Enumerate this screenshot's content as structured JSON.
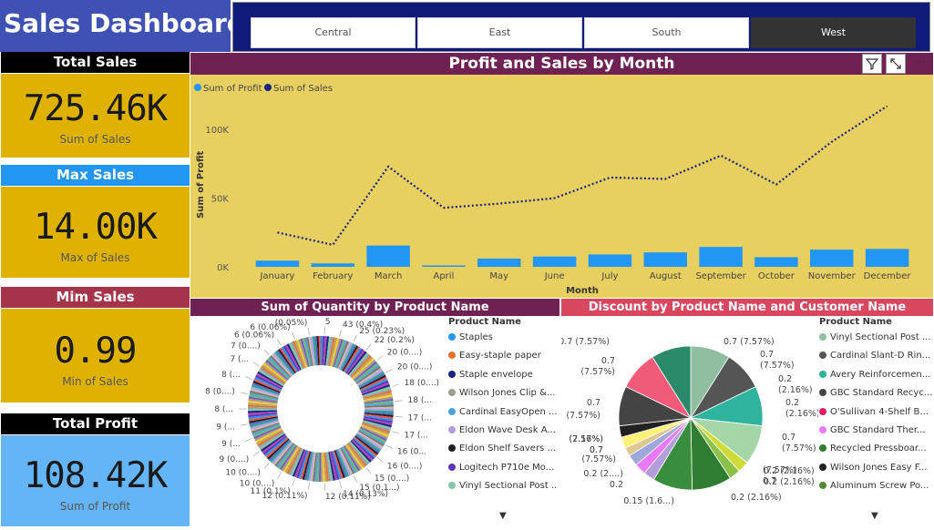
{
  "title": "Sales Dashboard",
  "slicer": [
    "Central",
    "East",
    "South",
    "West"
  ],
  "slicer_selected": "West",
  "kpis": [
    {
      "header": "Total Sales",
      "value": "725.46K",
      "sub": "Sum of Sales",
      "header_color": "#000000",
      "body_color": "#dfb200"
    },
    {
      "header": "Max Sales",
      "value": "14.00K",
      "sub": "Max of Sales",
      "header_color": "#2196f3",
      "body_color": "#dfb200"
    },
    {
      "header": "Mim Sales",
      "value": "0.99",
      "sub": "Min of Sales",
      "header_color": "#a5344a",
      "body_color": "#dfb200"
    },
    {
      "header": "Total Profit",
      "value": "108.42K",
      "sub": "Sum of Profit",
      "header_color": "#000000",
      "body_color": "#64b5f6"
    }
  ],
  "main_chart_title": "Profit and Sales by Month",
  "visual_icons": [
    "filter-icon",
    "focus-mode-icon",
    "more-options-icon"
  ],
  "qty_chart_title": "Sum of Quantity by Product Name",
  "disc_chart_title": "Discount by Product Name and Customer Name",
  "qty_legend": {
    "title": "Product Name",
    "items": [
      {
        "label": "Staples",
        "color": "#2196f3"
      },
      {
        "label": "Easy-staple paper",
        "color": "#e0742f"
      },
      {
        "label": "Staple envelope",
        "color": "#1a237e"
      },
      {
        "label": "Wilson Jones Clip &...",
        "color": "#9e9e8a"
      },
      {
        "label": "Cardinal EasyOpen ...",
        "color": "#4aa3df"
      },
      {
        "label": "Eldon Wave Desk A...",
        "color": "#b39ddb"
      },
      {
        "label": "Eldon Shelf Savers ...",
        "color": "#212121"
      },
      {
        "label": "Logitech P710e Mo...",
        "color": "#5e35b1"
      },
      {
        "label": "Vinyl Sectional Post ...",
        "color": "#81c7a8"
      }
    ]
  },
  "disc_legend": {
    "title": "Product Name",
    "items": [
      {
        "label": "Vinyl Sectional Post ...",
        "color": "#8fbfa0"
      },
      {
        "label": "Cardinal Slant-D Rin...",
        "color": "#555555"
      },
      {
        "label": "Avery Reinforcemen...",
        "color": "#2db39e"
      },
      {
        "label": "GBC Standard Recyc...",
        "color": "#444444"
      },
      {
        "label": "O'Sullivan 4-Shelf B...",
        "color": "#e91e63"
      },
      {
        "label": "GBC Standard Ther...",
        "color": "#e879f9"
      },
      {
        "label": "Recycled Pressboar...",
        "color": "#2e7d32"
      },
      {
        "label": "Wilson Jones Easy F...",
        "color": "#212121"
      },
      {
        "label": "Aluminum Screw Po...",
        "color": "#558b2f"
      }
    ]
  },
  "qty_labels": [
    "5",
    "43 (0.4%)",
    "25 (0.23%)",
    "22 (0.2%)",
    "20 (0....)",
    "20 (0....)",
    "18 (0....)",
    "18 (...",
    "17 (...",
    "17 (...",
    "16 (0...",
    "16 (0....)",
    "15 (0....)",
    "15 (0.1...)",
    "14 (0.13%)",
    "12 (0.11%)",
    "12 (0.11%)",
    "11 (0.1%)",
    "10 (0....)",
    "10 (0....)",
    "9 (0....)",
    "9 (...",
    "9 (...",
    "8 (...",
    "8 (0....)",
    "8 (...",
    "7 (...",
    "7 (0....)",
    "6 (0.06%)",
    "6 (0.06%)",
    "(0.05%)"
  ],
  "disc_labels": [
    "0.7 (7.57%)",
    "0.7 (7.57%)",
    "0.7",
    "(7.57%)",
    "0.7",
    "(7.57%)",
    "0.2",
    "(2.16%)",
    "0.2",
    "(2.16%)",
    "0.7",
    "(7.57%)",
    "0.7",
    "(7.57%)",
    "0.2 (2.16%)",
    "0.2 (2.16%)",
    "0.2 (2.16%)",
    "0.15 (1.6...)",
    "0.2 (2....)",
    "0.2",
    "(2.16%)",
    "0.7",
    "(7.57%)",
    "0.7",
    "(7.57%)",
    "0.7",
    "(7.57%)"
  ],
  "chart_data": [
    {
      "type": "bar",
      "title": "Profit and Sales by Month",
      "xlabel": "Month",
      "ylabel": "Sum of Profit",
      "categories": [
        "January",
        "February",
        "March",
        "April",
        "May",
        "June",
        "July",
        "August",
        "September",
        "October",
        "November",
        "December"
      ],
      "yticks": [
        "0K",
        "50K",
        "100K"
      ],
      "ylim": [
        0,
        120000
      ],
      "legend": "top-left",
      "series": [
        {
          "name": "Sum of Profit",
          "kind": "bar",
          "color": "#2196f3",
          "values": [
            4500,
            2500,
            15500,
            1000,
            6000,
            7500,
            9000,
            10500,
            14500,
            7000,
            12500,
            13000
          ]
        },
        {
          "name": "Sum of Sales",
          "kind": "line",
          "color": "#1a237e",
          "values": [
            25000,
            16000,
            73000,
            43000,
            46000,
            50000,
            65000,
            64000,
            81000,
            60000,
            91000,
            117000
          ]
        }
      ]
    },
    {
      "type": "pie",
      "title": "Sum of Quantity by Product Name",
      "subtype": "donut",
      "notes": "many small slices"
    },
    {
      "type": "pie",
      "title": "Discount by Product Name and Customer Name",
      "values": [
        0.7,
        0.7,
        0.7,
        0.7,
        0.2,
        0.2,
        0.7,
        0.7,
        0.2,
        0.2,
        0.2,
        0.15,
        0.2,
        0.2,
        0.7,
        0.7,
        0.7
      ]
    }
  ]
}
